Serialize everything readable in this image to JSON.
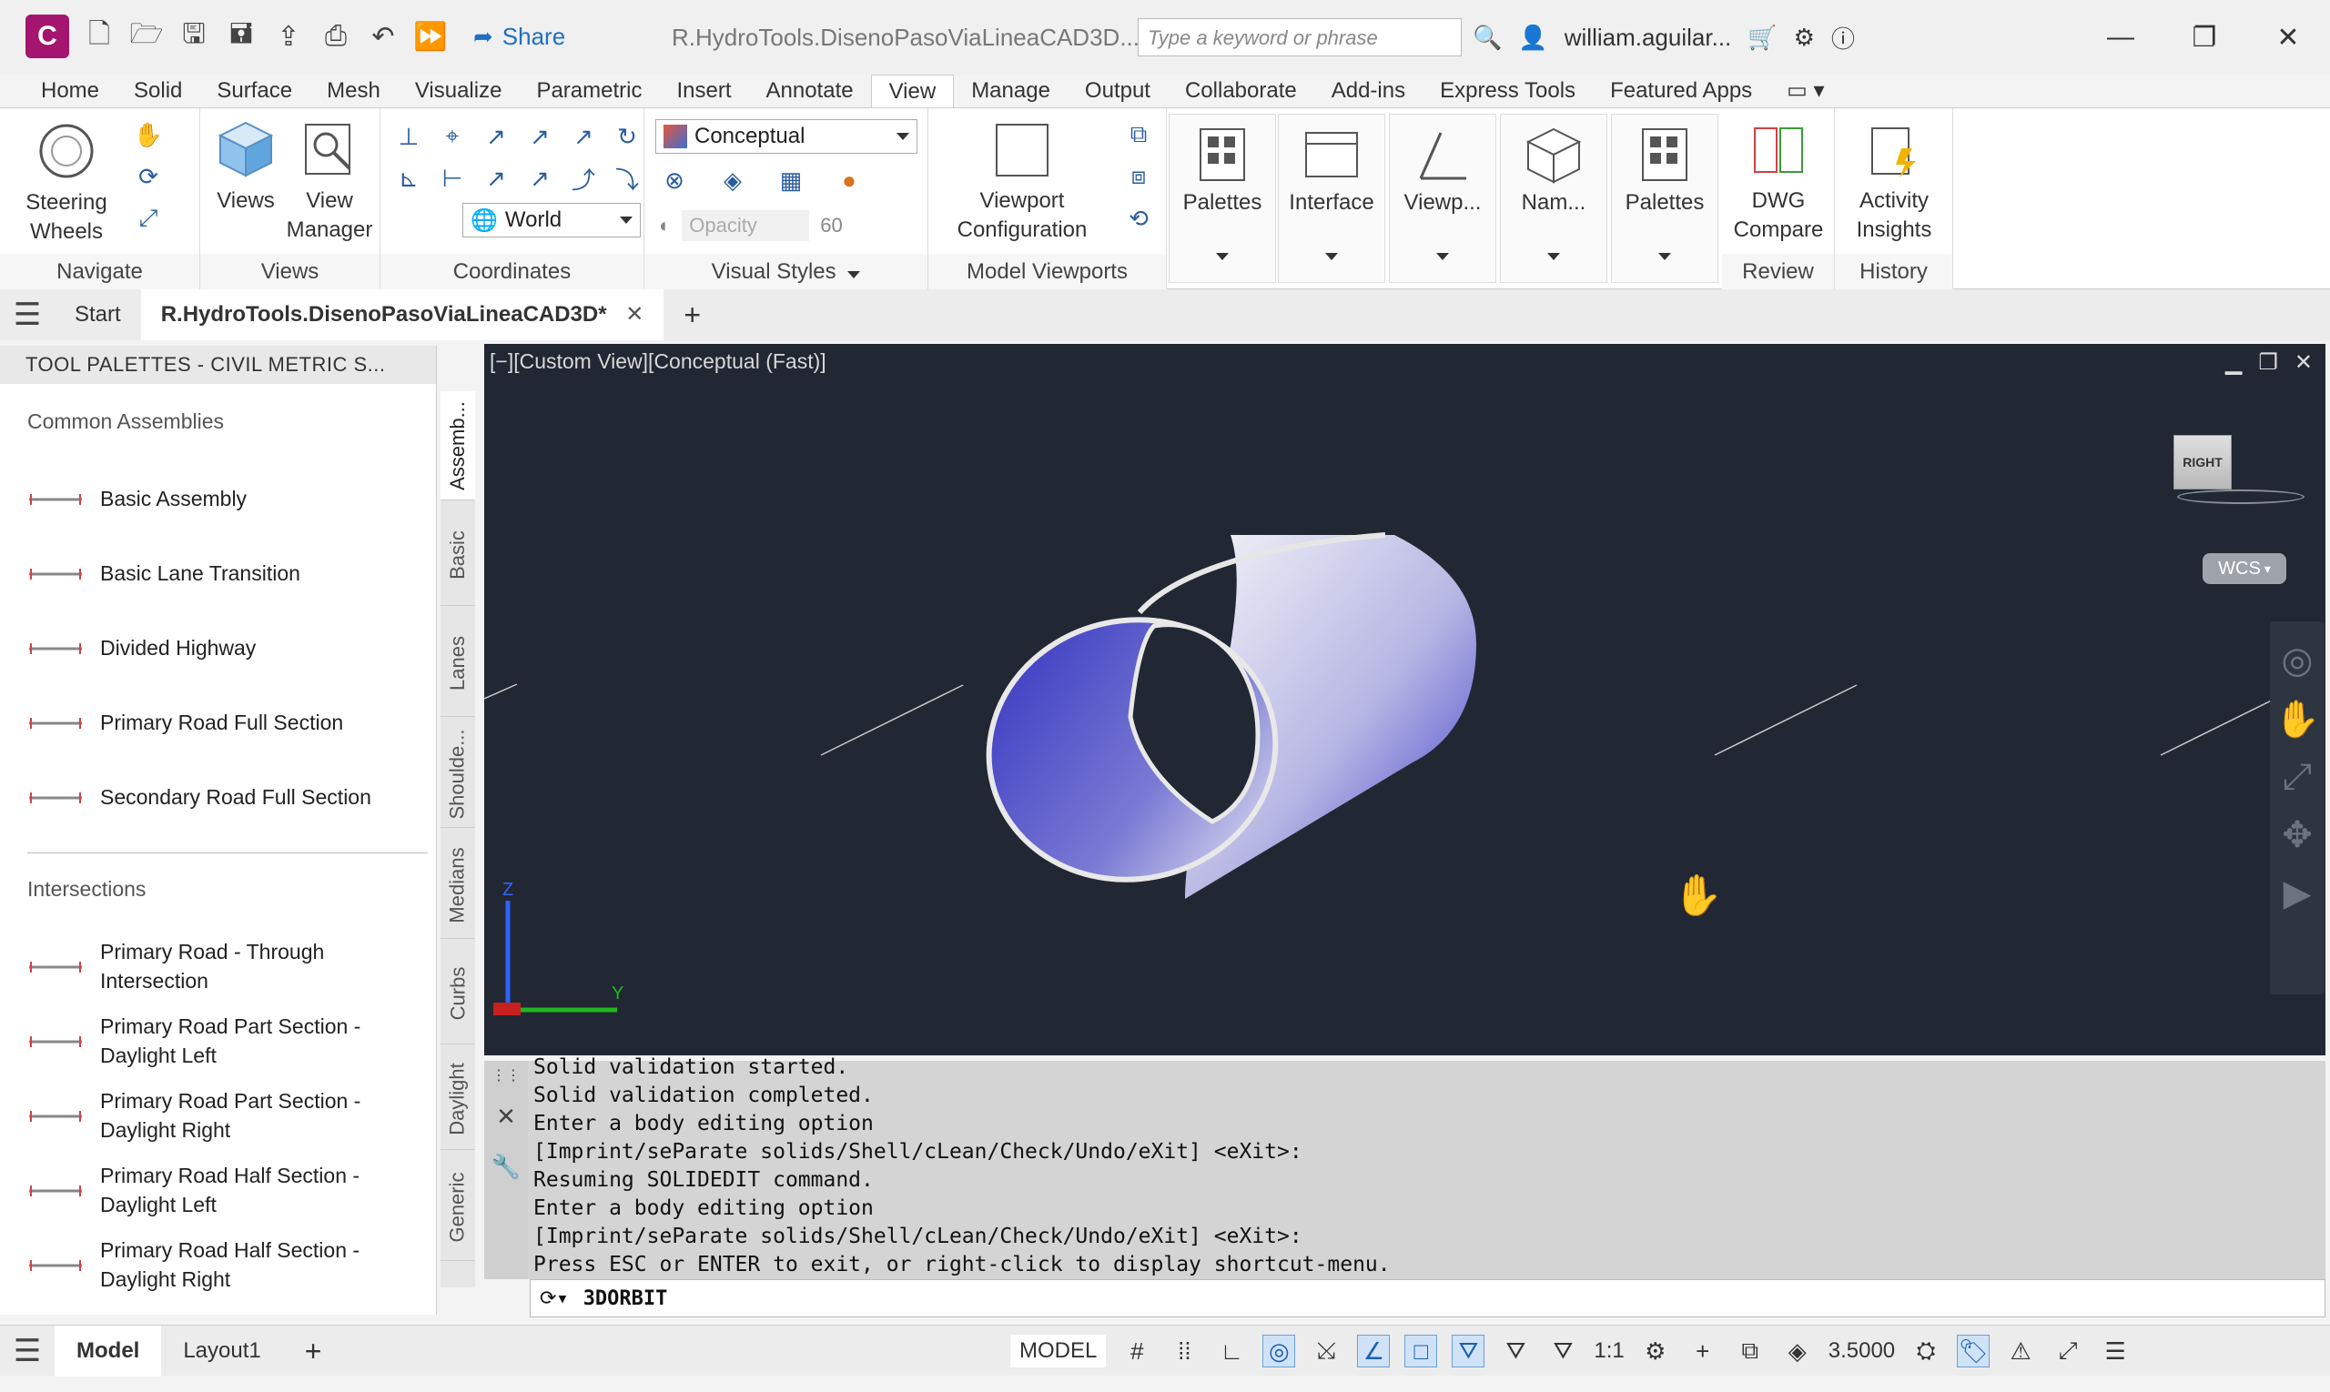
{
  "titlebar": {
    "app_logo": "C",
    "share_label": "Share",
    "doc_title": "R.HydroTools.DisenoPasoViaLineaCAD3D...",
    "search_placeholder": "Type a keyword or phrase",
    "user": "william.aguilar..."
  },
  "ribbon_tabs": [
    "Home",
    "Solid",
    "Surface",
    "Mesh",
    "Visualize",
    "Parametric",
    "Insert",
    "Annotate",
    "View",
    "Manage",
    "Output",
    "Collaborate",
    "Add-ins",
    "Express Tools",
    "Featured Apps"
  ],
  "ribbon_active_tab": "View",
  "ribbon": {
    "navigate": {
      "label": "Navigate",
      "steering_wheels": "Steering\nWheels"
    },
    "views": {
      "label": "Views",
      "views_btn": "Views",
      "view_manager": "View\nManager"
    },
    "coordinates": {
      "label": "Coordinates",
      "ucs_value": "World"
    },
    "visual_styles": {
      "label": "Visual Styles",
      "style_value": "Conceptual",
      "opacity_label": "Opacity",
      "opacity_value": "60"
    },
    "model_viewports": {
      "label": "Model Viewports",
      "viewport_config": "Viewport\nConfiguration"
    },
    "palettes_1": "Palettes",
    "interface": "Interface",
    "viewports": "Viewp...",
    "named": "Nam...",
    "palettes_2": "Palettes",
    "review": {
      "label": "Review",
      "dwg_compare": "DWG\nCompare"
    },
    "history": {
      "label": "History",
      "activity_insights": "Activity\nInsights"
    }
  },
  "file_tabs": {
    "start": "Start",
    "active": "R.HydroTools.DisenoPasoViaLineaCAD3D*"
  },
  "palette": {
    "title": "TOOL PALETTES - CIVIL METRIC S...",
    "section1": "Common Assemblies",
    "items1": [
      "Basic Assembly",
      "Basic Lane Transition",
      "Divided Highway",
      "Primary Road Full Section",
      "Secondary Road Full Section"
    ],
    "section2": "Intersections",
    "items2": [
      "Primary Road - Through\nIntersection",
      "Primary Road Part Section -\nDaylight Left",
      "Primary Road Part Section -\nDaylight Right",
      "Primary Road Half Section -\nDaylight Left",
      "Primary Road Half Section -\nDaylight Right"
    ],
    "vertical_tabs": [
      "Assemb...",
      "Basic",
      "Lanes",
      "Shoulde...",
      "Medians",
      "Curbs",
      "Daylight",
      "Generic"
    ]
  },
  "viewport": {
    "label": "[−][Custom View][Conceptual (Fast)]",
    "viewcube_face": "RIGHT",
    "wcs": "WCS",
    "ucs_z": "Z",
    "ucs_y": "Y"
  },
  "command": {
    "lines": [
      "Solid validation started.",
      "Solid validation completed.",
      "Enter a body editing option",
      "[Imprint/seParate solids/Shell/cLean/Check/Undo/eXit] <eXit>:",
      "Resuming SOLIDEDIT command.",
      "Enter a body editing option",
      "[Imprint/seParate solids/Shell/cLean/Check/Undo/eXit] <eXit>:",
      "Press ESC or ENTER to exit, or right-click to display shortcut-menu."
    ],
    "input": "3DORBIT"
  },
  "statusbar": {
    "model_tab": "Model",
    "layout_tab": "Layout1",
    "model_label": "MODEL",
    "scale": "1:1",
    "annotation_value": "3.5000"
  },
  "colors": {
    "accent": "#1f6fc4",
    "viewport_bg": "#212833",
    "tube_blue": "#3a3fc4",
    "brand": "#a3156e"
  }
}
